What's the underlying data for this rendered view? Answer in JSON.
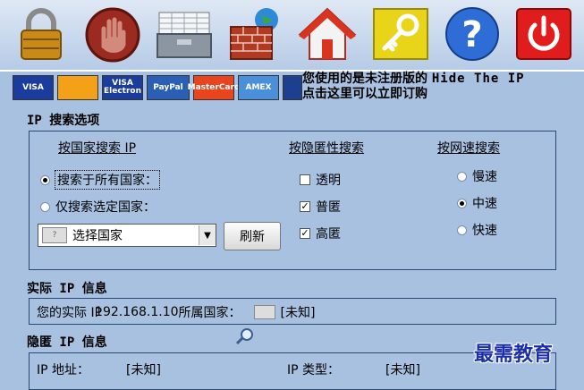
{
  "toolbar": {
    "buttons": [
      {
        "icon": "padlock-icon"
      },
      {
        "icon": "stop-hand-icon"
      },
      {
        "icon": "toolbox-icon"
      },
      {
        "icon": "firewall-globe-icon"
      },
      {
        "icon": "home-icon"
      },
      {
        "icon": "key-icon"
      },
      {
        "icon": "help-icon"
      },
      {
        "icon": "power-icon"
      }
    ]
  },
  "payment_cards": [
    {
      "label": "VISA",
      "color": "#1a3c9c",
      "text_color": "#ffffff"
    },
    {
      "label": "",
      "color": "#f4a11a",
      "text_color": "#1a3c9c"
    },
    {
      "label": "VISA Electron",
      "color": "#1a3c9c",
      "text_color": "#ffffff"
    },
    {
      "label": "PayPal",
      "color": "#2a5fb3",
      "text_color": "#ffffff"
    },
    {
      "label": "MasterCard",
      "color": "#e8451e",
      "text_color": "#ffffff"
    },
    {
      "label": "AMEX",
      "color": "#4a8fd9",
      "text_color": "#ffffff"
    },
    {
      "label": "",
      "color": "#1d3f8f",
      "text_color": "#ffffff"
    }
  ],
  "notice": {
    "line1_prefix": "您使用的是未注册版的",
    "line1_product": "Hide The IP",
    "line2": "点击这里可以立即订购"
  },
  "search": {
    "title": "IP 搜索选项",
    "by_country": {
      "header": "按国家搜索 IP",
      "all_countries": "搜索于所有国家：",
      "selected_countries": "仅搜索选定国家：",
      "select_value": "选择国家",
      "refresh_label": "刷新"
    },
    "by_anonymity": {
      "header": "按隐匿性搜索",
      "transparent": "透明",
      "anonymous": "普匿",
      "high": "高匿"
    },
    "by_speed": {
      "header": "按网速搜索",
      "slow": "慢速",
      "medium": "中速",
      "fast": "快速"
    }
  },
  "real_ip": {
    "title": "实际 IP 信息",
    "prefix": "您的实际 IP",
    "ip": "192.168.1.10",
    "country_label": "所属国家：",
    "country_value": "[未知]"
  },
  "hidden_ip": {
    "title": "隐匿 IP 信息",
    "address_label": "IP 地址：",
    "address_value": "[未知]",
    "type_label": "IP 类型：",
    "type_value": "[未知]"
  },
  "watermark": "最需教育"
}
